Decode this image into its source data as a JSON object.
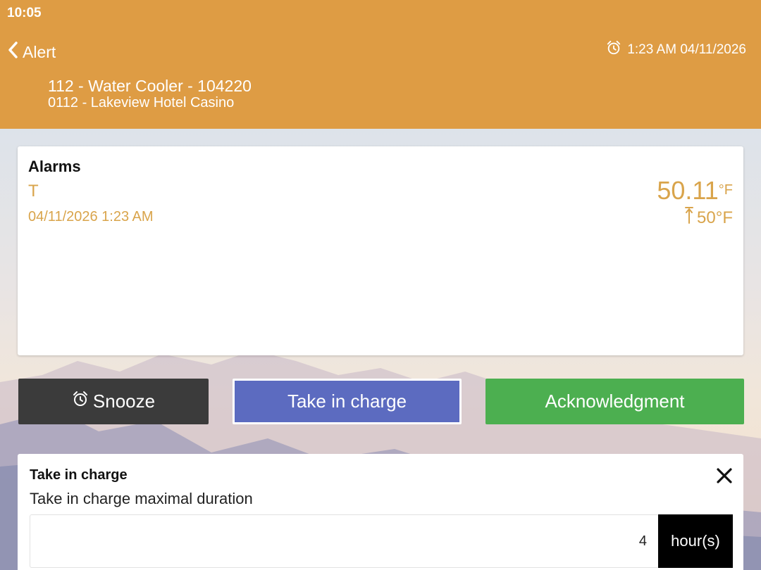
{
  "status_bar": {
    "time": "10:05"
  },
  "header": {
    "back_label": "Alert",
    "alarm_datetime": "1:23 AM 04/11/2026",
    "asset_line": "112 - Water Cooler - 104220",
    "site_line": "0112 - Lakeview Hotel Casino",
    "background_color": "#de9c44"
  },
  "alarms_card": {
    "title": "Alarms",
    "type": "T",
    "date": "04/11/2026 1:23 AM",
    "value": "50.11",
    "value_unit": "°F",
    "threshold": "50°F",
    "accent_color": "#d9a44b"
  },
  "actions": {
    "snooze_label": "Snooze",
    "take_in_charge_label": "Take in charge",
    "acknowledgment_label": "Acknowledgment",
    "colors": {
      "snooze": "#3b3b3b",
      "take_in_charge": "#5c6bc0",
      "acknowledgment": "#4caf50"
    }
  },
  "take_in_charge_panel": {
    "title": "Take in charge",
    "subtitle": "Take in charge maximal duration",
    "duration_value": "4",
    "duration_unit": "hour(s)"
  },
  "icons": {
    "back": "chevron-left-icon",
    "alarm": "alarm-clock-icon",
    "threshold": "arrow-up-bar-icon",
    "close": "close-icon"
  }
}
